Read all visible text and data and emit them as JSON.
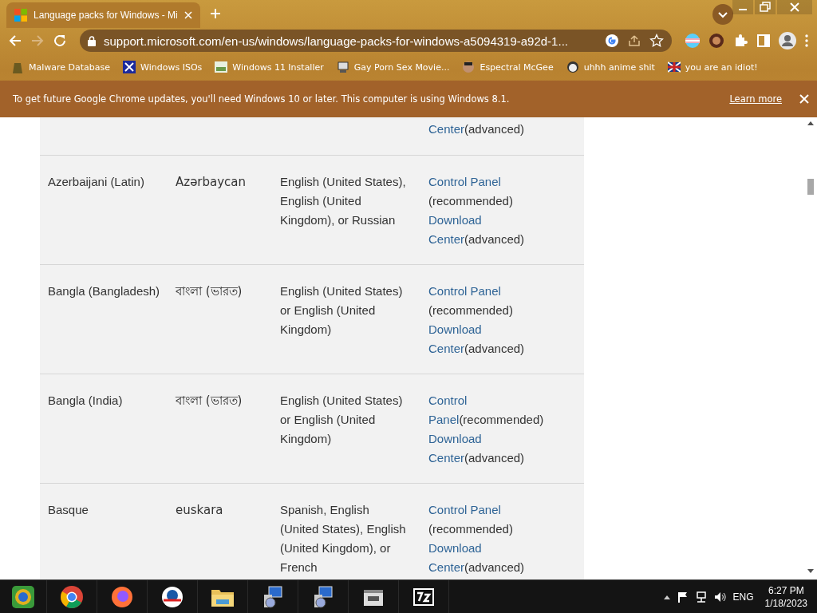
{
  "browser": {
    "tab": {
      "title": "Language packs for Windows - Mi",
      "selected": true
    },
    "address": "support.microsoft.com/en-us/windows/language-packs-for-windows-a5094319-a92d-1...",
    "bookmarks": [
      {
        "label": "Malware Database"
      },
      {
        "label": "Windows ISOs"
      },
      {
        "label": "Windows 11 Installer"
      },
      {
        "label": "Gay Porn Sex Movie..."
      },
      {
        "label": "Espectral McGee"
      },
      {
        "label": "uhhh anime shit"
      },
      {
        "label": "you are an idiot!"
      }
    ]
  },
  "infobar": {
    "message": "To get future Google Chrome updates, you'll need Windows 10 or later. This computer is using Windows 8.1.",
    "link": "Learn more"
  },
  "table": {
    "rows": [
      {
        "install": [
          [
            {
              "kind": "link",
              "text": "Center"
            },
            {
              "kind": "text",
              "text": "(advanced)"
            }
          ]
        ]
      },
      {
        "language": "Azerbaijani (Latin)",
        "native": "Azərbaycan",
        "base": "English (United States), English (United Kingdom), or Russian",
        "install": [
          [
            {
              "kind": "link",
              "text": "Control Panel"
            }
          ],
          [
            {
              "kind": "text",
              "text": "(recommended)"
            }
          ],
          [
            {
              "kind": "link",
              "text": "Download"
            }
          ],
          [
            {
              "kind": "link",
              "text": "Center"
            },
            {
              "kind": "text",
              "text": "(advanced)"
            }
          ]
        ]
      },
      {
        "language": "Bangla (Bangladesh)",
        "native": "বাংলা (ভারত)",
        "base": "English (United States) or English (United Kingdom)",
        "install": [
          [
            {
              "kind": "link",
              "text": "Control Panel"
            }
          ],
          [
            {
              "kind": "text",
              "text": "(recommended)"
            }
          ],
          [
            {
              "kind": "link",
              "text": "Download"
            }
          ],
          [
            {
              "kind": "link",
              "text": "Center"
            },
            {
              "kind": "text",
              "text": "(advanced)"
            }
          ]
        ]
      },
      {
        "language": "Bangla (India)",
        "native": "বাংলা (ভারত)",
        "base": "English (United States) or  English (United Kingdom)",
        "install": [
          [
            {
              "kind": "link",
              "text": "Control"
            }
          ],
          [
            {
              "kind": "link",
              "text": "Panel"
            },
            {
              "kind": "text",
              "text": "(recommended)"
            }
          ],
          [
            {
              "kind": "link",
              "text": "Download"
            }
          ],
          [
            {
              "kind": "link",
              "text": "Center"
            },
            {
              "kind": "text",
              "text": "(advanced)"
            }
          ]
        ]
      },
      {
        "language": "Basque",
        "native": "euskara",
        "base": "Spanish, English (United States), English (United Kingdom), or French",
        "install": [
          [
            {
              "kind": "link",
              "text": "Control Panel"
            }
          ],
          [
            {
              "kind": "text",
              "text": "(recommended)"
            }
          ],
          [
            {
              "kind": "link",
              "text": "Download"
            }
          ],
          [
            {
              "kind": "link",
              "text": "Center"
            },
            {
              "kind": "text",
              "text": "(advanced)"
            }
          ]
        ]
      }
    ]
  },
  "taskbar": {
    "language": "ENG",
    "time": "6:27 PM",
    "date": "1/18/2023"
  }
}
